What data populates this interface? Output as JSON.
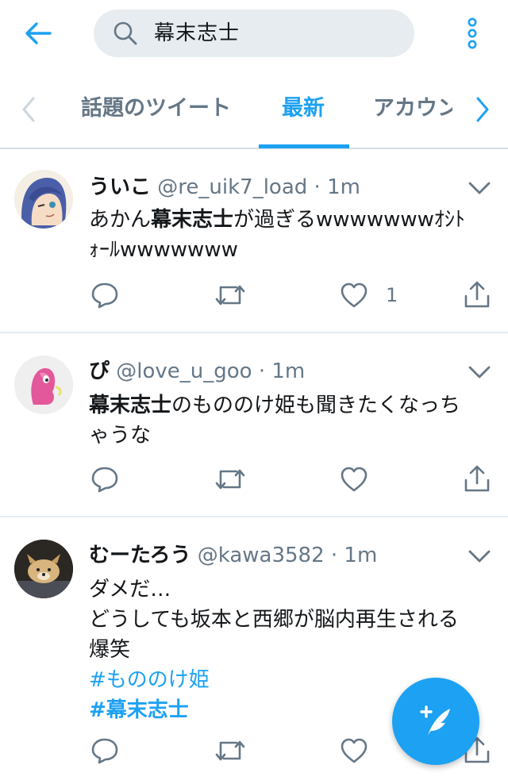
{
  "search": {
    "query": "幕末志士"
  },
  "tabs": [
    {
      "label": "話題のツイート",
      "active": false
    },
    {
      "label": "最新",
      "active": true
    },
    {
      "label": "アカウント",
      "active": false
    }
  ],
  "tweets": [
    {
      "name": "ういこ",
      "handle": "@re_uik7_load",
      "dot": "·",
      "time": "1m",
      "body_parts": [
        "あかん",
        "幕末志士",
        "が過ぎるwwwwwwwｵｼﾄ",
        "ｫｰﾙwwwwwww"
      ],
      "like_count": "1"
    },
    {
      "name": "ぴ",
      "handle": "@love_u_goo",
      "dot": "·",
      "time": "1m",
      "body_parts": [
        "幕末志士",
        "のもののけ姫も聞きたくなっち",
        "ゃうな"
      ],
      "like_count": ""
    },
    {
      "name": "むーたろう",
      "handle": "@kawa3582",
      "dot": "·",
      "time": "1m",
      "body_lines": [
        "ダメだ…",
        "どうしても坂本と西郷が脳内再生される",
        "爆笑"
      ],
      "hashtags": [
        "#もののけ姫",
        "#幕末志士"
      ],
      "like_count": ""
    }
  ],
  "icons": {
    "back": "arrow-left-icon",
    "search": "search-icon",
    "more": "more-vertical-icon",
    "reply": "reply-icon",
    "retweet": "retweet-icon",
    "like": "heart-icon",
    "share": "share-icon",
    "compose": "compose-feather-icon"
  },
  "colors": {
    "accent": "#1da1f2",
    "secondary_text": "#657786",
    "search_bg": "#e6ecf0"
  }
}
